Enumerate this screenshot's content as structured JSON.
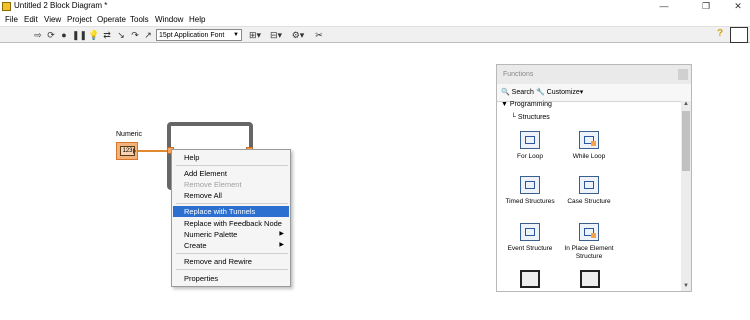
{
  "window": {
    "title": "Untitled 2 Block Diagram *",
    "minimize": "—",
    "restore": "❐",
    "close": "✕"
  },
  "menu": {
    "items": [
      "File",
      "Edit",
      "View",
      "Project",
      "Operate",
      "Tools",
      "Window",
      "Help"
    ]
  },
  "toolbar": {
    "font": "15pt Application Font"
  },
  "diagram": {
    "numeric_label": "Numeric",
    "numeric_value": "123"
  },
  "context_menu": {
    "items": [
      {
        "label": "Help",
        "state": "normal"
      },
      {
        "label": "Add Element",
        "state": "normal"
      },
      {
        "label": "Remove Element",
        "state": "disabled"
      },
      {
        "label": "Remove All",
        "state": "normal"
      },
      {
        "label": "Replace with Tunnels",
        "state": "highlighted"
      },
      {
        "label": "Replace with Feedback Node",
        "state": "normal"
      },
      {
        "label": "Numeric Palette",
        "state": "submenu"
      },
      {
        "label": "Create",
        "state": "submenu"
      },
      {
        "label": "Remove and Rewire",
        "state": "normal"
      },
      {
        "label": "Properties",
        "state": "normal"
      }
    ],
    "highlight_color": "#2b6fd1"
  },
  "palette": {
    "title": "Functions",
    "search": "Search",
    "customize": "Customize",
    "tree_root": "Programming",
    "tree_child": "Structures",
    "functions": [
      {
        "label": "For Loop"
      },
      {
        "label": "While Loop"
      },
      {
        "label": "Timed Structures"
      },
      {
        "label": "Case Structure"
      },
      {
        "label": "Event Structure"
      },
      {
        "label": "In Place Element Structure"
      }
    ]
  }
}
